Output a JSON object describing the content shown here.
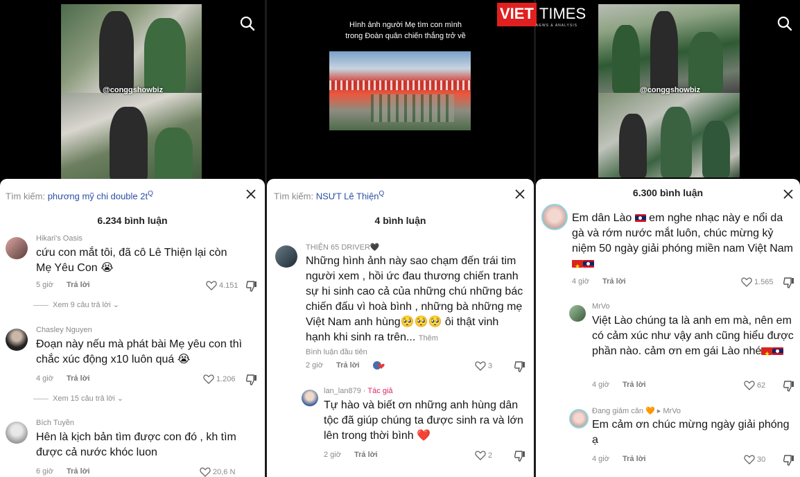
{
  "logo": {
    "part1": "VIET",
    "part2": "TIMES",
    "tagline": "NEWS & ANALYSIS"
  },
  "panels": [
    {
      "watermark": "@conggshowbiz",
      "search_label": "Tìm kiếm:",
      "search_query": "phương mỹ chi double 2t",
      "count": "6.234 bình luận",
      "comments": [
        {
          "user": "Hikari's Oasis",
          "text": "cứu con mắt tôi, đã cô Lê Thiện lại còn Mẹ Yêu Con 😭",
          "time": "5 giờ",
          "reply": "Trả lời",
          "likes": "4.151",
          "more": "Xem 9 câu trả lời ⌄"
        },
        {
          "user": "Chasley Nguyen",
          "text": "Đoạn này nếu mà phát bài Mẹ yêu con thì chắc xúc động x10 luôn quá 😭",
          "time": "4 giờ",
          "reply": "Trả lời",
          "likes": "1.206",
          "more": "Xem 15 câu trả lời ⌄"
        },
        {
          "user": "Bích Tuyền",
          "text": "Hên là kịch bản tìm được con đó , kh tìm được cả nước khóc luon",
          "time": "6 giờ",
          "reply": "Trả lời",
          "likes": "20,6 N"
        }
      ]
    },
    {
      "caption": "Hình ảnh người Mẹ tìm con mình trong Đoàn quân chiến thắng trở về",
      "search_label": "Tìm kiếm:",
      "search_query": "NSƯT Lê Thiện",
      "count": "4 bình luận",
      "comments": [
        {
          "user": "THIỆN 65 DRIVER🖤",
          "text": "Những hình ảnh này sao chạm đến trái tim người xem , hồi ức đau thương chiến tranh sự hi sinh cao cả của những chú những bác chiến đấu vì hoà bình , những bà những mẹ Việt Nam anh hùng🥺🥺🥺 ôi thật vinh hạnh khi sinh ra trên...",
          "more_link": "Thêm",
          "first_tag": "Bình luận đầu tiên",
          "time": "2 giờ",
          "reply": "Trả lời",
          "likes": "3"
        },
        {
          "user": "lan_lan879",
          "author_tag": "· Tác giả",
          "text": "Tự hào và biết ơn những anh hùng dân tộc đã giúp chúng ta được sinh ra và lớn lên trong thời bình ❤️",
          "time": "2 giờ",
          "reply": "Trả lời",
          "likes": "2"
        }
      ]
    },
    {
      "watermark": "@conggshowbiz",
      "count": "6.300 bình luận",
      "comments": [
        {
          "user": "",
          "text_pre": "Em dân Lào",
          "text_main": " em nghe nhạc này e nổi da gà và rớm nước mắt luôn, chúc mừng kỷ niệm 50 ngày giải phóng miền nam Việt Nam",
          "time": "4 giờ",
          "reply": "Trả lời",
          "likes": "1.565"
        },
        {
          "user": "MrVo",
          "text": "Việt Lào chúng ta là anh em mà, nên em có cảm xúc như vậy anh cũng hiểu được phần nào. cảm ơn em gái Lào nhé",
          "time": "4 giờ",
          "reply": "Trả lời",
          "likes": "62"
        },
        {
          "user": "Đang giảm cân 🧡 ▸ MrVo",
          "text": "Em cảm ơn chúc mừng ngày giải phóng ạ",
          "time": "4 giờ",
          "reply": "Trả lời",
          "likes": "30"
        }
      ]
    }
  ]
}
